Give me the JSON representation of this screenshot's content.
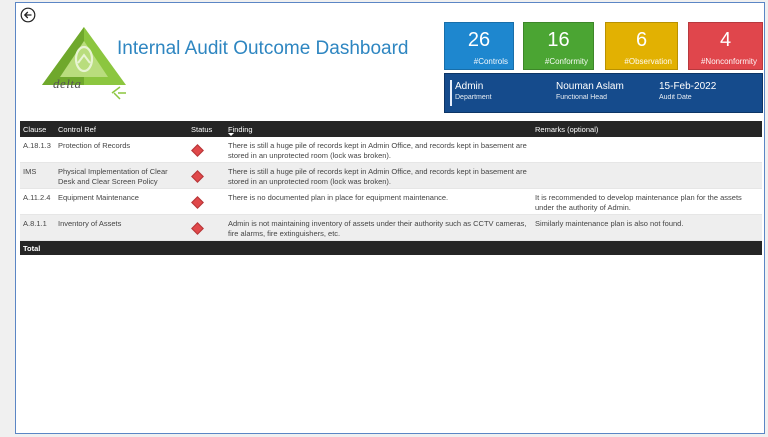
{
  "header": {
    "title": "Internal Audit Outcome Dashboard",
    "logo_text": "delta"
  },
  "cards": [
    {
      "value": "26",
      "label": "#Controls",
      "color": "#1e87cf"
    },
    {
      "value": "16",
      "label": "#Conformity",
      "color": "#4ba533"
    },
    {
      "value": "6",
      "label": "#Observation",
      "color": "#e2b102"
    },
    {
      "value": "4",
      "label": "#Nonconformity",
      "color": "#e0464c"
    }
  ],
  "info": {
    "department": {
      "value": "Admin",
      "label": "Department"
    },
    "head": {
      "value": "Nouman Aslam",
      "label": "Functional Head"
    },
    "date": {
      "value": "15-Feb-2022",
      "label": "Audit Date"
    }
  },
  "table": {
    "columns": [
      "Clause",
      "Control Ref",
      "Status",
      "Finding",
      "Remarks (optional)"
    ],
    "rows": [
      {
        "clause": "A.18.1.3",
        "control": "Protection of Records",
        "status": "red-diamond",
        "finding": "There is still a huge pile of records kept in Admin Office, and records kept in basement are stored in an unprotected room (lock was broken).",
        "remarks": ""
      },
      {
        "clause": "IMS",
        "control": "Physical Implementation of Clear Desk and Clear Screen Policy",
        "status": "red-diamond",
        "finding": "There is still a huge pile of records kept in Admin Office, and records kept in basement are stored in an unprotected room (lock was broken).",
        "remarks": ""
      },
      {
        "clause": "A.11.2.4",
        "control": "Equipment Maintenance",
        "status": "red-diamond",
        "finding": "There is no documented plan in place for equipment maintenance.",
        "remarks": "It is recommended to develop maintenance plan for the assets under the authority of Admin."
      },
      {
        "clause": "A.8.1.1",
        "control": "Inventory of Assets",
        "status": "red-diamond",
        "finding": "Admin is not maintaining inventory of assets under their authority such as CCTV cameras, fire alarms, fire extinguishers, etc.",
        "remarks": "Similarly maintenance plan is also not found."
      }
    ],
    "total_label": "Total"
  }
}
